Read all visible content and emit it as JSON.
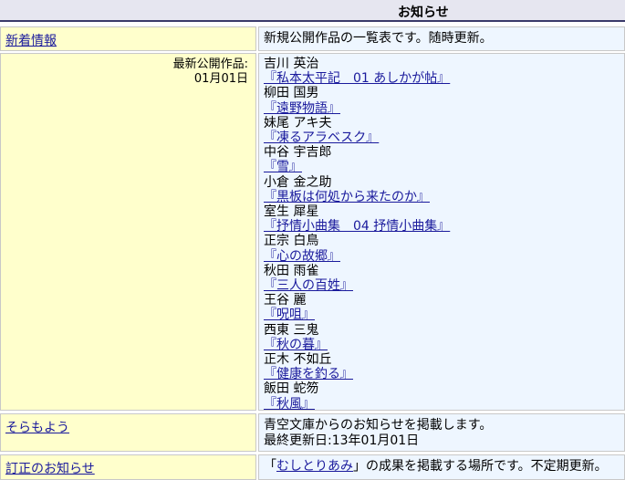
{
  "header": {
    "title": "お知らせ"
  },
  "rows": {
    "new_arrivals": {
      "link": "新着情報",
      "text": "新規公開作品の一覧表です。随時更新。"
    },
    "latest": {
      "label_line1": "最新公開作品:",
      "label_line2": "01月01日",
      "entries": [
        {
          "author": "吉川 英治",
          "title": "『私本太平記　01 あしかが帖』"
        },
        {
          "author": "柳田 国男",
          "title": "『遠野物語』"
        },
        {
          "author": "妹尾 アキ夫",
          "title": "『凍るアラベスク』"
        },
        {
          "author": "中谷 宇吉郎",
          "title": "『雪』"
        },
        {
          "author": "小倉 金之助",
          "title": "『黒板は何処から来たのか』"
        },
        {
          "author": "室生 犀星",
          "title": "『抒情小曲集　04 抒情小曲集』"
        },
        {
          "author": "正宗 白鳥",
          "title": "『心の故郷』"
        },
        {
          "author": "秋田 雨雀",
          "title": "『三人の百姓』"
        },
        {
          "author": "王谷 麗",
          "title": "『呪咀』"
        },
        {
          "author": "西東 三鬼",
          "title": "『秋の暮』"
        },
        {
          "author": "正木 不如丘",
          "title": "『健康を釣る』"
        },
        {
          "author": "飯田 蛇笏",
          "title": "『秋風』"
        }
      ]
    },
    "sora": {
      "link": "そらもよう",
      "line1": "青空文庫からのお知らせを掲載します。",
      "line2": "最終更新日:13年01月01日"
    },
    "errata": {
      "link": "訂正のお知らせ",
      "text_open": "「",
      "text_link": "むしとりあみ",
      "text_rest": "」の成果を掲載する場所です。不定期更新。"
    }
  }
}
